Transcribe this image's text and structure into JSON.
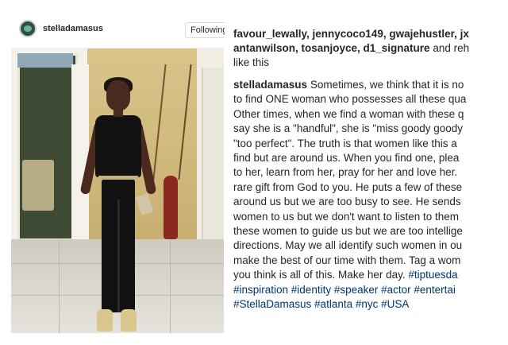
{
  "post": {
    "username": "stelladamasus",
    "follow_label": "Following"
  },
  "likes": {
    "line1": "favour_lewally, jennycoco149, gwajehustler, jx",
    "line2": "antanwilson, tosanjoyce, d1_signature",
    "line2_suffix": " and reh",
    "line3": "like this"
  },
  "caption": {
    "username": "stelladamasus",
    "lines": [
      " Sometimes, we think that it is no",
      "to find ONE woman who possesses all these qua",
      "Other times, when we find a woman with these q",
      "say she is a \"handful\", she is \"miss goody goody",
      "\"too perfect\". The truth is that women like this a",
      "find but are around us. When you find one, plea",
      "to her, learn from her, pray for her and love her.",
      "rare gift from God to you. He puts a few of these",
      "around us but we are too busy to see. He sends",
      "women to us but we don't want to listen to them",
      "these women to guide us but we are too intellige",
      "directions. May we all identify such women in ou",
      "make the best of our time with them. Tag a wom",
      "you think is all of this. Make her day."
    ],
    "line14_tag": " #tiptuesda",
    "hashtag_line1": "#inspiration #identity #speaker #actor #entertai",
    "hashtag_line2": "#StellaDamasus #atlanta #nyc #USA"
  },
  "colors": {
    "text": "#262626",
    "hashtag": "#003569",
    "border": "#dbdbdb"
  },
  "icons": {
    "avatar": "profile-avatar"
  }
}
